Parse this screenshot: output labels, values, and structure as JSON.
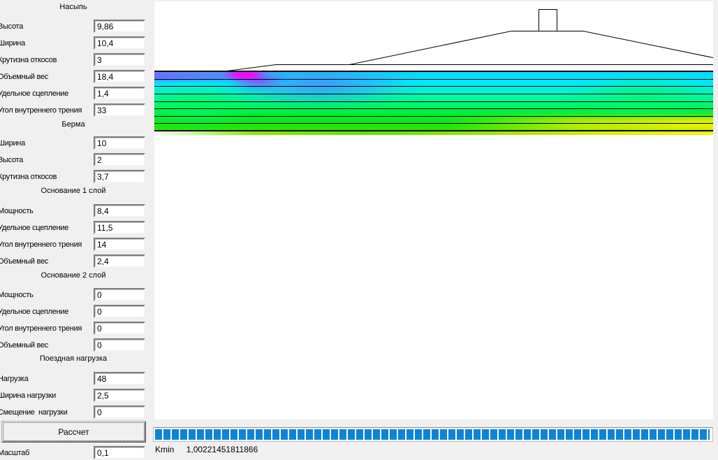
{
  "form": {
    "sections": [
      {
        "title": "Насыпь",
        "fields": [
          {
            "label": "Высота",
            "value": "9,86"
          },
          {
            "label": "Ширина",
            "value": "10,4"
          },
          {
            "label": "Крутизна откосов",
            "value": "3"
          },
          {
            "label": "Объемный вес",
            "value": "18,4"
          },
          {
            "label": "Удельное сцепление",
            "value": "1,4"
          },
          {
            "label": "Угол внутреннего трения",
            "value": "33"
          }
        ]
      },
      {
        "title": "Берма",
        "fields": [
          {
            "label": "Ширина",
            "value": "10"
          },
          {
            "label": "Высота",
            "value": "2"
          },
          {
            "label": "Крутизна откосов",
            "value": "3,7"
          }
        ]
      },
      {
        "title": "Основание 1 слой",
        "fields": [
          {
            "label": "Мощность",
            "value": "8,4"
          },
          {
            "label": "Удельное сцепление",
            "value": "11,5"
          },
          {
            "label": "Угол внутреннего трения",
            "value": "14"
          },
          {
            "label": "Объемный вес",
            "value": "2,4"
          }
        ]
      },
      {
        "title": "Основание 2 слой",
        "fields": [
          {
            "label": "Мощность",
            "value": "0"
          },
          {
            "label": "Удельное сцепление",
            "value": "0"
          },
          {
            "label": "Угол внутреннего трения",
            "value": "0"
          },
          {
            "label": "Объемный вес",
            "value": "0"
          }
        ]
      },
      {
        "title": "Поездная нагрузка",
        "fields": [
          {
            "label": "Нагрузка",
            "value": "48"
          },
          {
            "label": "Ширина нагрузки",
            "value": "2,5"
          },
          {
            "label": "Смещение  нагрузки",
            "value": "0"
          }
        ]
      }
    ],
    "calc_button_label": "Рассчет",
    "scale_field": {
      "label": "Масштаб",
      "value": "0,1"
    }
  },
  "status": {
    "kmin_label": "Kmin",
    "kmin_value": "1,00221451811866"
  },
  "colors": {
    "window_bg": "#f0f0f0",
    "canvas_bg": "#ffffff",
    "progress_blue": "#0b84da",
    "heatmap_palette": {
      "violet": "#805cff",
      "magenta": "#ff00ff",
      "blue": "#488cff",
      "cyan": "#00e2ff",
      "spring_green": "#00f77f",
      "green": "#11e811",
      "yellow_green": "#aaee00",
      "yellow": "#f0f000"
    }
  }
}
